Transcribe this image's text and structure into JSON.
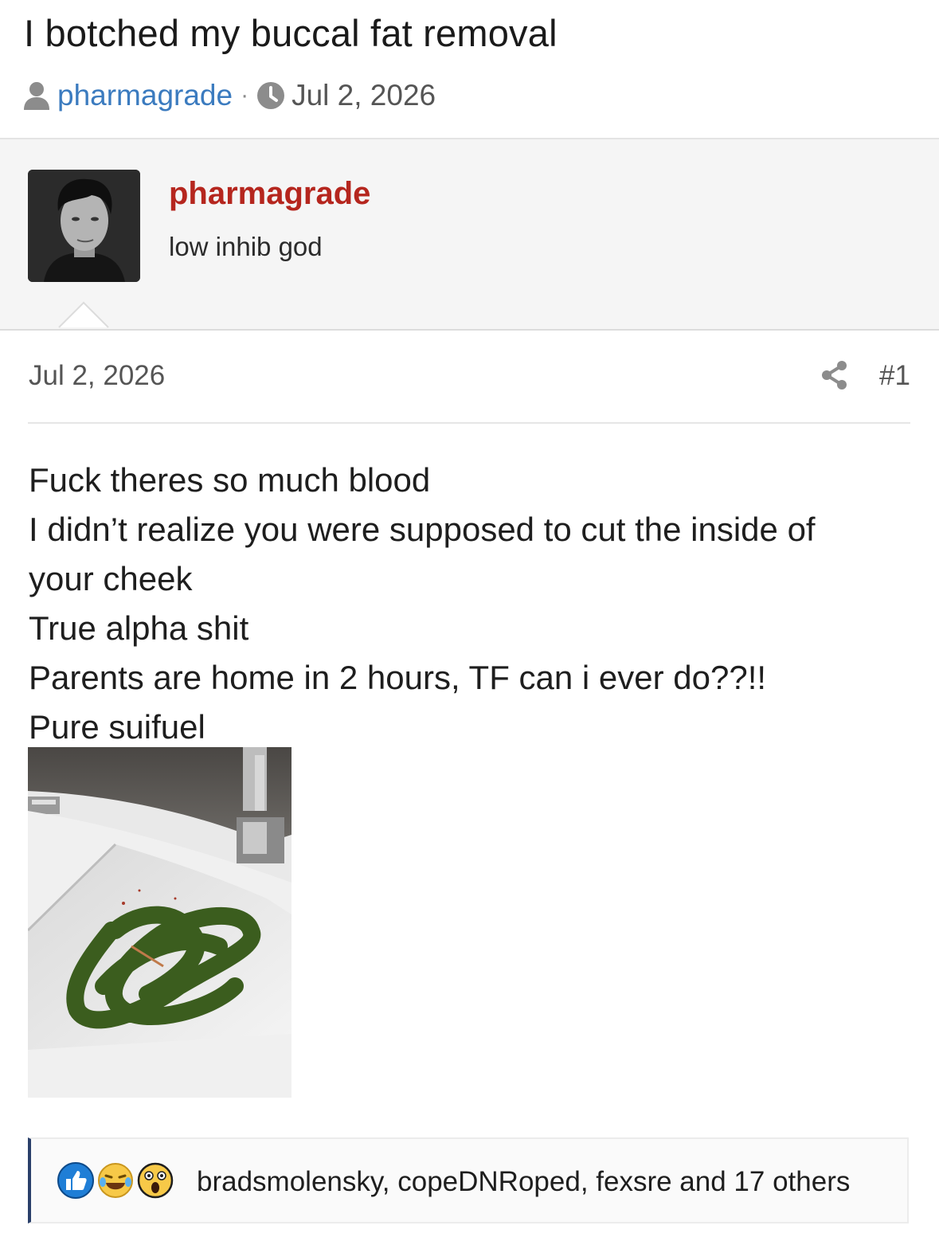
{
  "thread": {
    "title": "I botched my buccal fat removal",
    "author": "pharmagrade",
    "separator": "·",
    "date": "Jul 2, 2026"
  },
  "poster": {
    "username": "pharmagrade",
    "user_title": "low inhib god",
    "username_color": "#b5261e"
  },
  "post": {
    "date": "Jul 2, 2026",
    "number": "#1",
    "lines": [
      "Fuck theres so much blood",
      "I didn’t realize you were supposed to cut the inside of",
      "your cheek",
      "True alpha shit",
      "Parents are home in 2 hours, TF can i ever do??!!",
      "Pure suifuel"
    ],
    "attachment_icon": "photo-sink-scribbled"
  },
  "reactions": {
    "icons": [
      "like-icon",
      "laugh-cry-icon",
      "wow-icon"
    ],
    "summary": "bradsmolensky, copeDNRoped, fexsre and 17 others"
  },
  "colors": {
    "link_blue": "#3b7bbf",
    "reaction_border": "#2a3f6a",
    "scribble_green": "#3b5d1e"
  }
}
